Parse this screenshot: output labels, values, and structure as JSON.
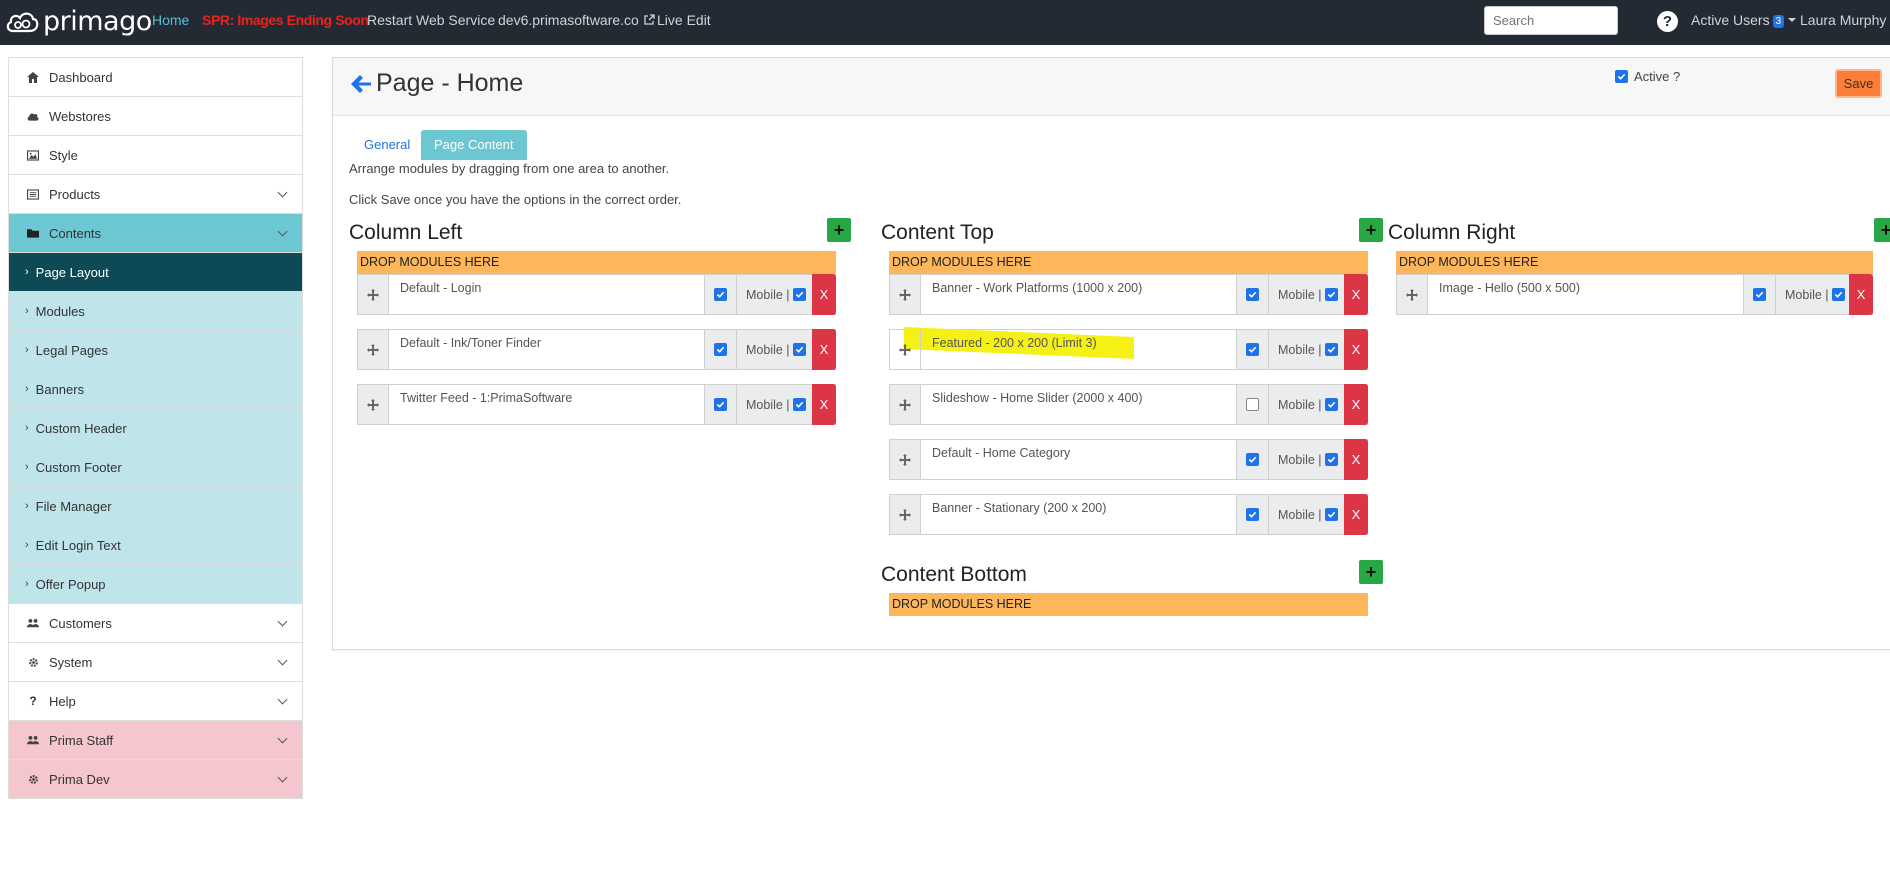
{
  "navbar": {
    "logo": "primago",
    "links": [
      {
        "label": "Home",
        "style": "active"
      },
      {
        "label": "SPR: Images Ending Soon",
        "style": "alert"
      },
      {
        "label": "Restart Web Service",
        "style": "normal"
      },
      {
        "label": "dev6.primasoftware.co",
        "style": "normal",
        "external": true
      },
      {
        "label": "Live Edit",
        "style": "normal"
      }
    ],
    "search_placeholder": "Search",
    "help_label": "?",
    "active_users_label": "Active Users",
    "active_users_count": "3",
    "user_name": "Laura Murphy"
  },
  "sidebar": {
    "items": [
      {
        "label": "Dashboard",
        "icon": "home-icon",
        "type": "top"
      },
      {
        "label": "Webstores",
        "icon": "cloud-icon",
        "type": "top"
      },
      {
        "label": "Style",
        "icon": "image-icon",
        "type": "top"
      },
      {
        "label": "Products",
        "icon": "list-icon",
        "type": "top",
        "expandable": true
      },
      {
        "label": "Contents",
        "icon": "folder-icon",
        "type": "open",
        "expandable": true
      },
      {
        "label": "Page Layout",
        "type": "current"
      },
      {
        "label": "Modules",
        "type": "sub"
      },
      {
        "label": "Legal Pages",
        "type": "sub"
      },
      {
        "label": "Banners",
        "type": "sub"
      },
      {
        "label": "Custom Header",
        "type": "sub"
      },
      {
        "label": "Custom Footer",
        "type": "sub"
      },
      {
        "label": "File Manager",
        "type": "sub"
      },
      {
        "label": "Edit Login Text",
        "type": "sub"
      },
      {
        "label": "Offer Popup",
        "type": "sub"
      },
      {
        "label": "Customers",
        "icon": "users-icon",
        "type": "top",
        "expandable": true
      },
      {
        "label": "System",
        "icon": "gear-icon",
        "type": "top",
        "expandable": true
      },
      {
        "label": "Help",
        "icon": "question-icon",
        "type": "top",
        "expandable": true
      },
      {
        "label": "Prima Staff",
        "icon": "users-icon",
        "type": "staff",
        "expandable": true
      },
      {
        "label": "Prima Dev",
        "icon": "gear-icon",
        "type": "staff",
        "expandable": true
      }
    ]
  },
  "page": {
    "title": "Page - Home",
    "active_label": "Active ?",
    "active_checked": true,
    "save_label": "Save",
    "tabs": [
      {
        "label": "General",
        "selected": false
      },
      {
        "label": "Page Content",
        "selected": true
      }
    ],
    "help_line_1": "Arrange modules by dragging from one area to another.",
    "help_line_2": "Click Save once you have the options in the correct order.",
    "drop_label": "DROP MODULES HERE",
    "add_label": "+",
    "mobile_label": "Mobile |",
    "remove_label": "X",
    "columns": [
      {
        "title": "Column Left",
        "modules": [
          {
            "name": "Default - Login",
            "enabled": true,
            "mobile": true
          },
          {
            "name": "Default - Ink/Toner Finder",
            "enabled": true,
            "mobile": true
          },
          {
            "name": "Twitter Feed - 1:PrimaSoftware",
            "enabled": true,
            "mobile": true
          }
        ]
      },
      {
        "title": "Content Top",
        "modules": [
          {
            "name": "Banner - Work Platforms (1000 x 200)",
            "enabled": true,
            "mobile": true
          },
          {
            "name": "Featured - 200 x 200 (Limit 3)",
            "enabled": true,
            "mobile": true,
            "highlighted": true
          },
          {
            "name": "Slideshow - Home Slider (2000 x 400)",
            "enabled": false,
            "mobile": true
          },
          {
            "name": "Default - Home Category",
            "enabled": true,
            "mobile": true
          },
          {
            "name": "Banner - Stationary (200 x 200)",
            "enabled": true,
            "mobile": true
          }
        ]
      },
      {
        "title": "Column Right",
        "modules": [
          {
            "name": "Image - Hello (500 x 500)",
            "enabled": true,
            "mobile": true
          }
        ]
      },
      {
        "title": "Content Bottom",
        "modules": []
      }
    ],
    "colors": {
      "accent": "#6cc7d2",
      "current": "#0e4a55",
      "drop": "#fdb65a",
      "add": "#28a745",
      "remove": "#dc3545",
      "save": "#fd7e36",
      "highlight": "#f4f00a"
    }
  }
}
